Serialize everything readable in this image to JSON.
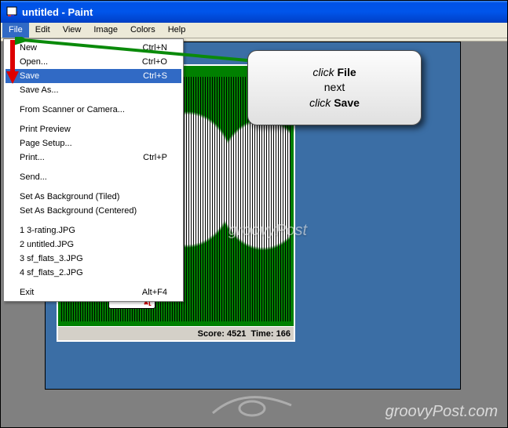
{
  "window": {
    "title": "untitled - Paint"
  },
  "menubar": {
    "items": [
      "File",
      "Edit",
      "View",
      "Image",
      "Colors",
      "Help"
    ]
  },
  "file_menu": {
    "new": {
      "label": "New",
      "shortcut": "Ctrl+N"
    },
    "open": {
      "label": "Open...",
      "shortcut": "Ctrl+O"
    },
    "save": {
      "label": "Save",
      "shortcut": "Ctrl+S"
    },
    "save_as": {
      "label": "Save As..."
    },
    "scanner": {
      "label": "From Scanner or Camera..."
    },
    "preview": {
      "label": "Print Preview"
    },
    "page_setup": {
      "label": "Page Setup..."
    },
    "print": {
      "label": "Print...",
      "shortcut": "Ctrl+P"
    },
    "send": {
      "label": "Send..."
    },
    "bg_tiled": {
      "label": "Set As Background (Tiled)"
    },
    "bg_center": {
      "label": "Set As Background (Centered)"
    },
    "recent": [
      "1 3-rating.JPG",
      "2 untitled.JPG",
      "3 sf_flats_3.JPG",
      "4 sf_flats_2.JPG"
    ],
    "exit": {
      "label": "Exit",
      "shortcut": "Alt+F4"
    }
  },
  "solitaire": {
    "card_rank": "J",
    "card_suit": "♥",
    "status": {
      "score_label": "Score:",
      "score": "4521",
      "time_label": "Time:",
      "time": "166"
    }
  },
  "callout": {
    "line1a": "click ",
    "line1b": "File",
    "line2": "next",
    "line3a": "click ",
    "line3b": "Save"
  },
  "branding": {
    "watermark": "groovyPost",
    "footer": "groovyPost.com"
  }
}
